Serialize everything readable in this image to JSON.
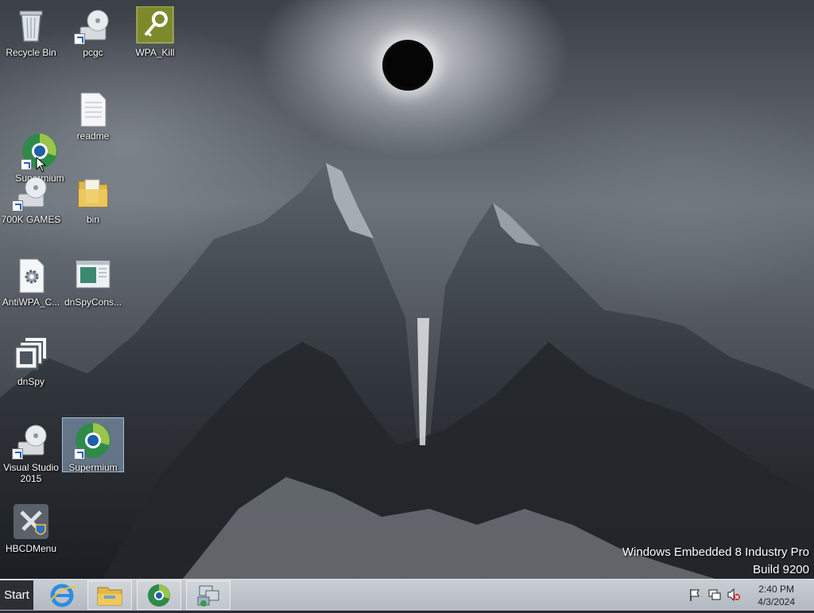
{
  "desktop": {
    "icons": [
      {
        "label": "Recycle Bin",
        "icon": "recycle-bin-icon"
      },
      {
        "label": "pcgc",
        "icon": "disc-installer-icon"
      },
      {
        "label": "WPA_Kill",
        "icon": "key-icon"
      },
      {
        "label": "readme",
        "icon": "text-document-icon"
      },
      {
        "label": "Supermium",
        "icon": "supermium-browser-icon"
      },
      {
        "label": "700K GAMES",
        "icon": "disc-installer-icon"
      },
      {
        "label": "bin",
        "icon": "folder-icon"
      },
      {
        "label": "AntiWPA_C...",
        "icon": "gear-document-icon"
      },
      {
        "label": "dnSpyCons...",
        "icon": "console-window-icon"
      },
      {
        "label": "dnSpy",
        "icon": "stacked-windows-icon"
      },
      {
        "label": "Visual Studio 2015",
        "label_line1": "Visual Studio",
        "label_line2": "2015",
        "icon": "disc-installer-icon"
      },
      {
        "label": "Supermium",
        "icon": "supermium-browser-icon",
        "selected": true
      },
      {
        "label": "HBCDMenu",
        "icon": "tools-shield-icon"
      }
    ]
  },
  "watermark": {
    "line1": "Windows Embedded 8 Industry Pro",
    "line2": "Build 9200"
  },
  "taskbar": {
    "start_label": "Start",
    "pinned": [
      {
        "name": "Internet Explorer",
        "icon": "internet-explorer-icon"
      },
      {
        "name": "File Explorer",
        "icon": "file-explorer-icon"
      },
      {
        "name": "Supermium",
        "icon": "supermium-browser-icon"
      },
      {
        "name": "Network setup",
        "icon": "network-computer-icon"
      }
    ],
    "tray": {
      "icons": [
        "action-center-flag-icon",
        "network-icon",
        "volume-muted-icon"
      ],
      "time": "2:40 PM",
      "date": "4/3/2024"
    }
  },
  "colors": {
    "taskbar": "#b8bec5",
    "start_button": "#2b2f34",
    "selection": "#aacdf0"
  }
}
